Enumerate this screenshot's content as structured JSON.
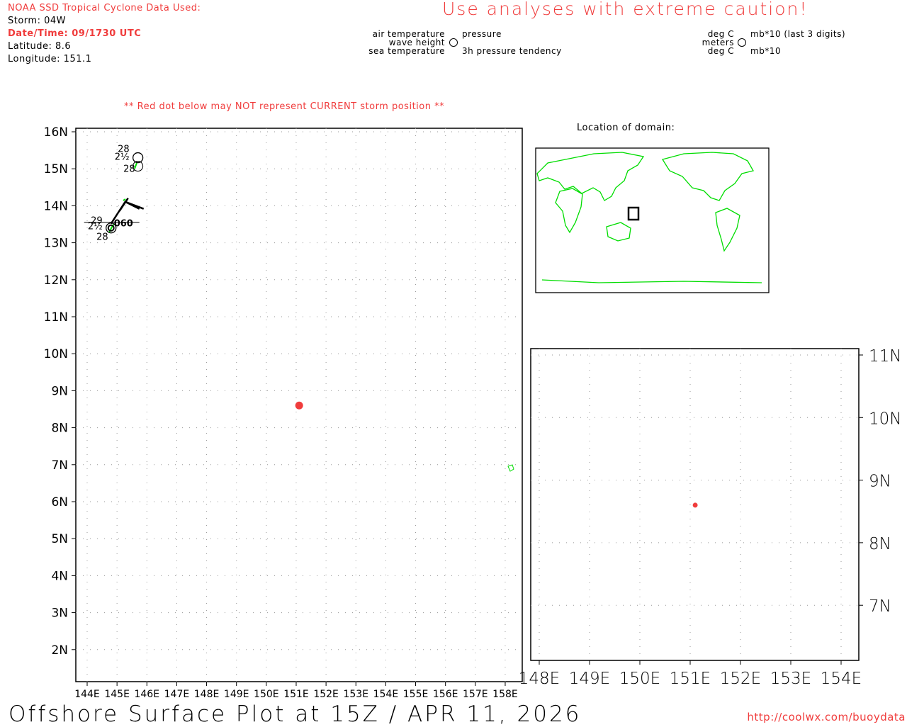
{
  "header": {
    "source": "NOAA SSD Tropical Cyclone Data Used:",
    "storm": "Storm: 04W",
    "datetime": "Date/Time: 09/1730 UTC",
    "latitude": "Latitude: 8.6",
    "longitude": "Longitude: 151.1",
    "caution": "Use analyses with extreme caution!",
    "red_dot_note": "** Red dot below may NOT represent CURRENT storm position **"
  },
  "legend": {
    "air_temp": "air temperature",
    "wave_height": "wave height",
    "sea_temp": "sea temperature",
    "pressure": "pressure",
    "tendency": "3h pressure tendency",
    "deg_c_1": "deg C",
    "meters": "meters",
    "deg_c_2": "deg C",
    "mb_last3": "mb*10 (last 3 digits)",
    "mb": "mb*10"
  },
  "main_map": {
    "lat_labels": [
      "16N",
      "15N",
      "14N",
      "13N",
      "12N",
      "11N",
      "10N",
      "9N",
      "8N",
      "7N",
      "6N",
      "5N",
      "4N",
      "3N",
      "2N"
    ],
    "lon_labels": [
      "144E",
      "145E",
      "146E",
      "147E",
      "148E",
      "149E",
      "150E",
      "151E",
      "152E",
      "153E",
      "154E",
      "155E",
      "156E",
      "157E",
      "158E"
    ],
    "storm_position": {
      "lat": 8.6,
      "lon": 151.1
    },
    "stations": [
      {
        "lat": 15.3,
        "lon": 145.7,
        "air": "28",
        "wave": "2½",
        "sea": "28"
      },
      {
        "lat": 13.4,
        "lon": 144.8,
        "air": "29",
        "wave": "2½",
        "sea": "28",
        "pressure": "060"
      }
    ]
  },
  "domain_map": {
    "title": "Location of domain:"
  },
  "zoom_map": {
    "lat_labels": [
      "11N",
      "10N",
      "9N",
      "8N",
      "7N"
    ],
    "lon_labels": [
      "148E",
      "149E",
      "150E",
      "151E",
      "152E",
      "153E",
      "154E"
    ]
  },
  "footer": {
    "title": "Offshore Surface Plot at 15Z / APR 11, 2026",
    "url": "http://coolwx.com/buoydata"
  },
  "colors": {
    "land": "#00dd00",
    "storm": "#f03c3c",
    "text_red": "#f03c3c"
  }
}
